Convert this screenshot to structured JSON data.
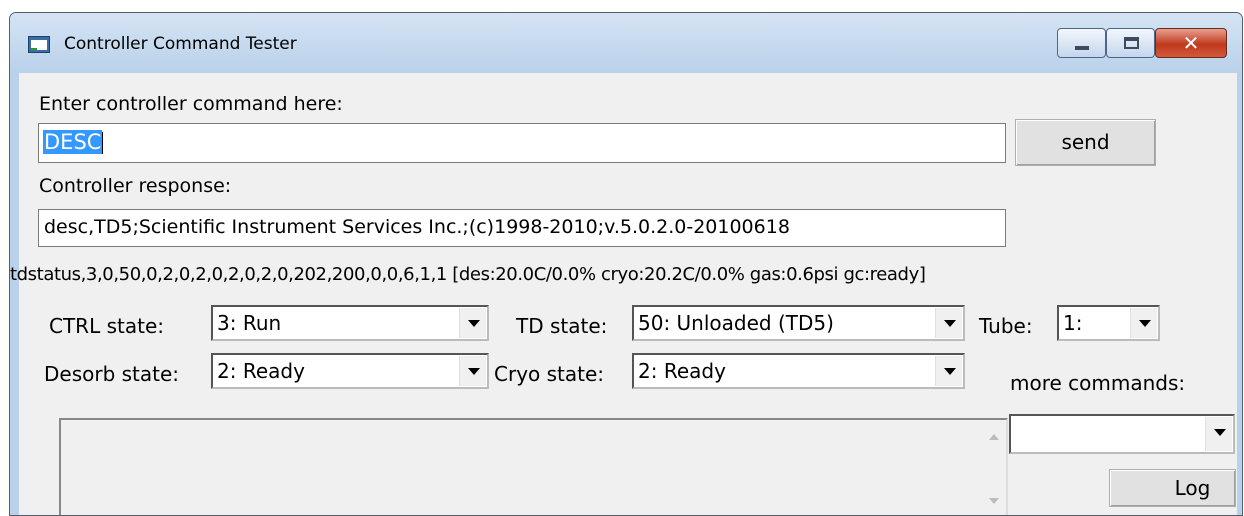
{
  "window": {
    "title": "Controller Command Tester"
  },
  "command": {
    "label": "Enter controller command here:",
    "value": "DESC",
    "send_label": "send"
  },
  "response": {
    "label": "Controller response:",
    "value": "desc,TD5;Scientific Instrument Services Inc.;(c)1998-2010;v.5.0.2.0-20100618"
  },
  "status_line": "tdstatus,3,0,50,0,2,0,2,0,2,0,2,0,202,200,0,0,6,1,1 [des:20.0C/0.0% cryo:20.2C/0.0% gas:0.6psi gc:ready]",
  "ctrl_state": {
    "label": "CTRL state:",
    "value": "3: Run"
  },
  "td_state": {
    "label": "TD state:",
    "value": "50: Unloaded (TD5)"
  },
  "tube": {
    "label": "Tube:",
    "value": "1:"
  },
  "desorb_state": {
    "label": "Desorb state:",
    "value": "2: Ready"
  },
  "cryo_state": {
    "label": "Cryo state:",
    "value": "2: Ready"
  },
  "more_commands": {
    "label": "more commands:",
    "value": ""
  },
  "log_label": "Log",
  "icons": {
    "app": "app-window-icon",
    "minimize": "minimize-icon",
    "maximize": "maximize-icon",
    "close": "close-icon",
    "dropdown": "chevron-down-icon"
  }
}
